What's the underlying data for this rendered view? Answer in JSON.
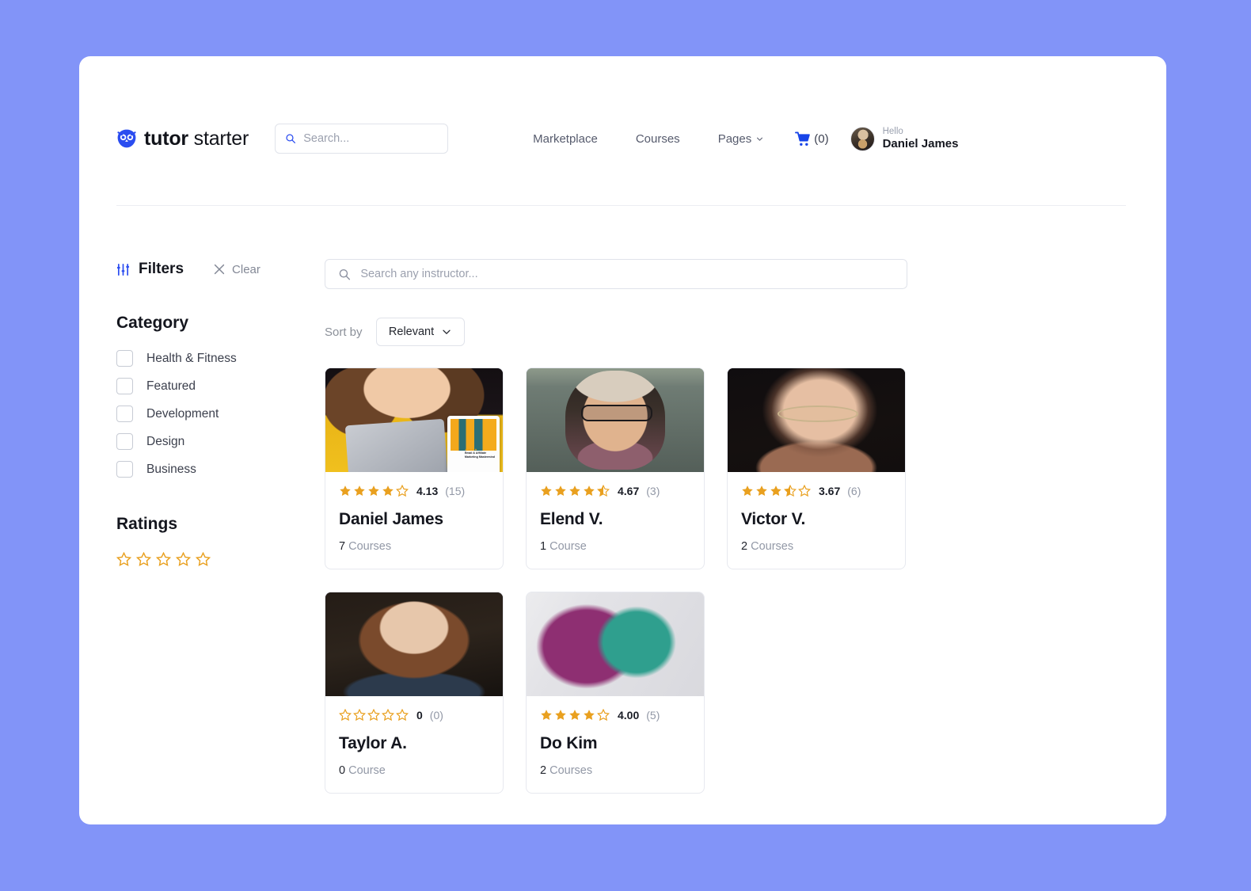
{
  "theme": {
    "page_bg": "#8294f8",
    "card_bg": "#ffffff",
    "accent_blue": "#2b4df0",
    "star_gold": "#e9a01f"
  },
  "header": {
    "brand_bold": "tutor",
    "brand_light": "starter",
    "logo_icon": "owl-icon",
    "search": {
      "placeholder": "Search...",
      "value": "",
      "icon": "search-icon"
    },
    "nav": [
      {
        "label": "Marketplace",
        "has_caret": false
      },
      {
        "label": "Courses",
        "has_caret": false
      },
      {
        "label": "Pages",
        "has_caret": true,
        "caret_icon": "chevron-down-icon"
      }
    ],
    "cart": {
      "icon": "shopping-cart-icon",
      "count_label": "(0)"
    },
    "user": {
      "greeting": "Hello",
      "name": "Daniel James",
      "avatar_icon": "user-avatar"
    }
  },
  "sidebar": {
    "filters_label": "Filters",
    "filters_icon": "sliders-icon",
    "clear_label": "Clear",
    "clear_icon": "close-x-icon",
    "category_title": "Category",
    "categories": [
      {
        "label": "Health & Fitness",
        "checked": false
      },
      {
        "label": "Featured",
        "checked": false
      },
      {
        "label": "Development",
        "checked": false
      },
      {
        "label": "Design",
        "checked": false
      },
      {
        "label": "Business",
        "checked": false
      }
    ],
    "ratings_title": "Ratings",
    "ratings_filter": {
      "stars_total": 5,
      "selected": 0,
      "star_icon": "star-outline-icon"
    }
  },
  "main": {
    "search": {
      "placeholder": "Search any instructor...",
      "value": "",
      "icon": "search-icon"
    },
    "sort_by_label": "Sort by",
    "sort_value": "Relevant",
    "sort_caret_icon": "chevron-down-icon",
    "instructors": [
      {
        "name": "Daniel James",
        "rating_value": "4.13",
        "rating_count": "(15)",
        "full_stars": 4,
        "half_star": false,
        "empty_stars": 1,
        "course_count": "7",
        "course_word": "Courses",
        "photo_class": "ph-daniel",
        "photo_alt": "woman in yellow sweater holding tablet",
        "badge": {
          "stars": "★★★★",
          "line1": "Email & Affiliate",
          "line2": "Marketing Mastermind"
        }
      },
      {
        "name": "Elend V.",
        "rating_value": "4.67",
        "rating_count": "(3)",
        "full_stars": 4,
        "half_star": true,
        "empty_stars": 0,
        "course_count": "1",
        "course_word": "Course",
        "photo_class": "ph-elend",
        "photo_alt": "man with hat glasses and scarf"
      },
      {
        "name": "Victor V.",
        "rating_value": "3.67",
        "rating_count": "(6)",
        "full_stars": 3,
        "half_star": true,
        "empty_stars": 1,
        "course_count": "2",
        "course_word": "Courses",
        "photo_class": "ph-victor",
        "photo_alt": "man with glasses in dark room"
      },
      {
        "name": "Taylor A.",
        "rating_value": "0",
        "rating_count": "(0)",
        "full_stars": 0,
        "half_star": false,
        "empty_stars": 5,
        "course_count": "0",
        "course_word": "Course",
        "photo_class": "ph-taylor",
        "photo_alt": "woman with curly hair dark portrait"
      },
      {
        "name": "Do Kim",
        "rating_value": "4.00",
        "rating_count": "(5)",
        "full_stars": 4,
        "half_star": false,
        "empty_stars": 1,
        "course_count": "2",
        "course_word": "Courses",
        "photo_class": "ph-dokim",
        "photo_alt": "profile of woman with teal and magenta lighting"
      }
    ]
  }
}
